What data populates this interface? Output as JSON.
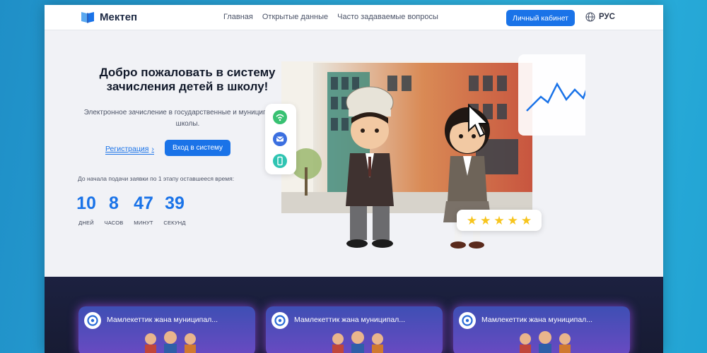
{
  "header": {
    "logo_text": "Мектеп",
    "nav": [
      "Главная",
      "Открытые данные",
      "Часто задаваемые вопросы"
    ],
    "cabinet_label": "Личный кабинет",
    "language": "РУС",
    "icons": {
      "logo": "book-icon",
      "language": "globe-icon"
    }
  },
  "hero": {
    "title": "Добро пожаловать в систему зачисления детей в школу!",
    "subtitle": "Электронное зачисление в государственные и муниципальные школы.",
    "register_label": "Регистрация",
    "login_label": "Вход в систему",
    "countdown_label": "До начала подачи заявки по 1 этапу оставшееся время:",
    "countdown": [
      {
        "value": "10",
        "unit": "ДНЕЙ"
      },
      {
        "value": "8",
        "unit": "ЧАСОВ"
      },
      {
        "value": "47",
        "unit": "МИНУТ"
      },
      {
        "value": "39",
        "unit": "СЕКУНД"
      }
    ],
    "rating_stars": 5
  },
  "videos": [
    {
      "title": "Мамлекеттик жана муниципал..."
    },
    {
      "title": "Мамлекеттик жана муниципал..."
    },
    {
      "title": "Мамлекеттик жана муниципал..."
    }
  ],
  "colors": {
    "accent": "#1a73e8",
    "background": "#f1f2f6",
    "dark_section": "#1c2140",
    "star": "#f7c51e"
  }
}
